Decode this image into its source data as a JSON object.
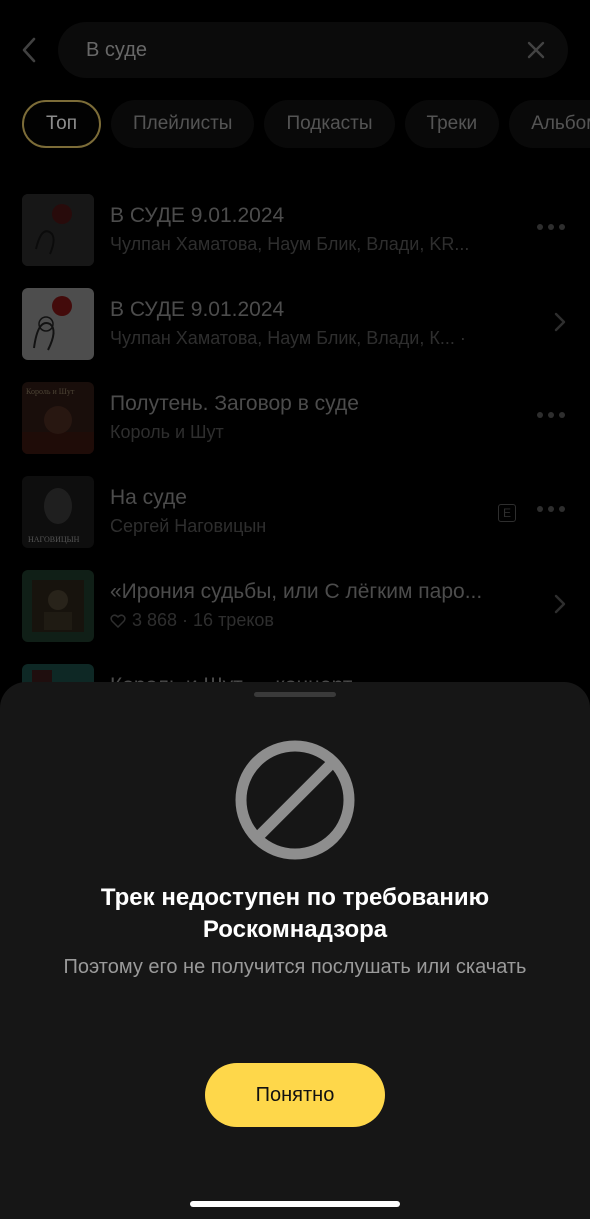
{
  "header": {
    "search_value": "В суде"
  },
  "chips": [
    {
      "label": "Топ",
      "active": true
    },
    {
      "label": "Плейлисты"
    },
    {
      "label": "Подкасты"
    },
    {
      "label": "Треки"
    },
    {
      "label": "Альбомы"
    }
  ],
  "results": [
    {
      "title": "В СУДЕ 9.01.2024",
      "subtitle": "Чулпан Хаматова, Наум Блик, Влади, KR...",
      "action": "more"
    },
    {
      "title": "В СУДЕ 9.01.2024",
      "subtitle": "Чулпан Хаматова, Наум Блик, Влади, К... ·",
      "action": "chevron"
    },
    {
      "title": "Полутень. Заговор в суде",
      "subtitle": "Король и Шут",
      "action": "more",
      "cover_text": "Король и Шут"
    },
    {
      "title": "На суде",
      "subtitle": "Сергей Наговицын",
      "action": "more",
      "explicit": "E",
      "cover_text": "НАГОВИЦЫН"
    },
    {
      "title": "«Ирония судьбы, или С лёгким паро...",
      "subtitle": "3 868 · 16 треков",
      "action": "chevron"
    },
    {
      "title": "Король и Шут — концерт",
      "subtitle": "",
      "action": "more"
    }
  ],
  "sheet": {
    "title": "Трек недоступен по требованию Роскомнадзора",
    "subtitle": "Поэтому его не получится послушать или скачать",
    "button_label": "Понятно"
  },
  "colors": {
    "accent": "#fed74a",
    "chip_active_border": "#e2c566",
    "sheet_bg": "#161616"
  },
  "icons": [
    "back-arrow-icon",
    "clear-icon",
    "more-dots-icon",
    "chevron-right-icon",
    "heart-icon",
    "explicit-icon",
    "blocked-icon"
  ]
}
